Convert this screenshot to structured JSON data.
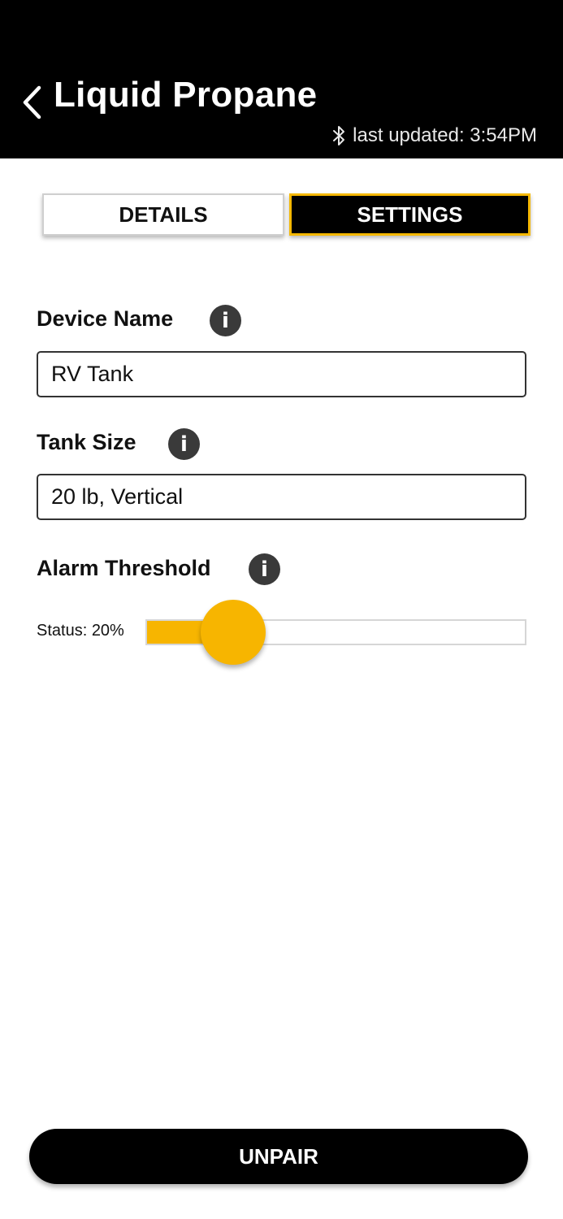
{
  "header": {
    "title": "Liquid Propane",
    "last_updated": "last updated: 3:54PM",
    "back_icon": "chevron-left-icon",
    "bluetooth_icon": "bluetooth-icon"
  },
  "tabs": [
    {
      "label": "DETAILS",
      "active": false
    },
    {
      "label": "SETTINGS",
      "active": true
    }
  ],
  "fields": {
    "device_name": {
      "label": "Device Name",
      "value": "RV Tank"
    },
    "tank_size": {
      "label": "Tank Size",
      "value": "20 lb, Vertical"
    },
    "alarm_threshold": {
      "label": "Alarm Threshold",
      "status_text": "Status: 20%",
      "level_percent": 20
    }
  },
  "info_icon_glyph": "i",
  "footer": {
    "unpair_label": "UNPAIR"
  },
  "colors": {
    "accent": "#f7b500",
    "header_bg": "#000000",
    "button_bg": "#000000"
  }
}
